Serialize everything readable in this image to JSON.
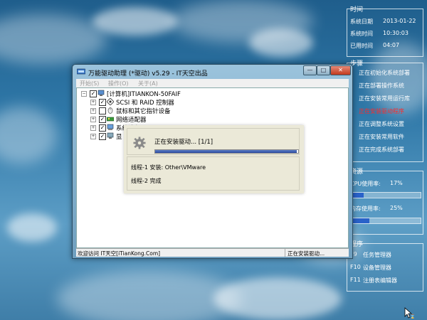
{
  "panel_time": {
    "title": "时间",
    "rows": [
      {
        "label": "系统日期",
        "value": "2013-01-22"
      },
      {
        "label": "系统时间",
        "value": "10:30:03"
      },
      {
        "label": "已用时间",
        "value": "04:07"
      }
    ]
  },
  "panel_steps": {
    "title": "步骤",
    "steps": [
      {
        "key": "1",
        "label": "正在初始化系统部署"
      },
      {
        "key": "2",
        "label": "正在部署操作系统"
      },
      {
        "key": "3",
        "label": "正在安装常用运行库"
      },
      {
        "key": "4",
        "label": "正在安装驱动程序"
      },
      {
        "key": "5",
        "label": "正在调整系统设置"
      },
      {
        "key": "6",
        "label": "正在安装常用软件"
      },
      {
        "key": "7",
        "label": "正在完成系统部署"
      }
    ],
    "active_index": 3,
    "active_color": "#ff2a2a"
  },
  "panel_resource": {
    "title": "资源",
    "cpu_label": "CPU使用率:",
    "cpu_value": "17%",
    "cpu_fraction": 0.17,
    "mem_label": "内存使用率:",
    "mem_value": "25%",
    "mem_fraction": 0.25
  },
  "panel_tools": {
    "title": "程序",
    "items": [
      {
        "key": "F9",
        "label": "任务管理器"
      },
      {
        "key": "F10",
        "label": "设备管理器"
      },
      {
        "key": "F11",
        "label": "注册表编辑器"
      }
    ]
  },
  "window": {
    "title": "万能驱动助理 (*驱动) v5.29 - IT天空出品",
    "controls": {
      "minimize": "—",
      "maximize": "□",
      "close": "✕"
    },
    "menu": [
      "开始(S)",
      "操作(O)",
      "关于(A)"
    ],
    "tree": [
      {
        "label": "[计算机]ITIANKON-50FAIF",
        "level": 0,
        "expanded": true,
        "checked": true,
        "icon": "computer-icon"
      },
      {
        "label": "SCSI 和 RAID 控制器",
        "level": 1,
        "checked": true,
        "icon": "scsi-controller-icon"
      },
      {
        "label": "鼠标和其它指针设备",
        "level": 1,
        "checked": false,
        "icon": "mouse-icon"
      },
      {
        "label": "网络适配器",
        "level": 1,
        "checked": true,
        "icon": "network-adapter-icon"
      },
      {
        "label": "系统设备",
        "level": 1,
        "checked": true,
        "icon": "system-device-icon"
      },
      {
        "label": "显",
        "level": 1,
        "checked": true,
        "icon": "display-adapter-icon"
      }
    ],
    "status_left": "欢迎访问 IT天空[iTianKong.Com]",
    "status_right": "正在安装驱动..."
  },
  "dialog": {
    "title": "正在安装驱动... [1/1]",
    "progress_fraction": 0.99,
    "threads": [
      "线程-1 安装:  Other\\VMware",
      "线程-2 完成"
    ]
  },
  "colors": {
    "accent": "#2a62c9",
    "progress": "#2c4aa0",
    "step_active": "#ff2a2a"
  }
}
